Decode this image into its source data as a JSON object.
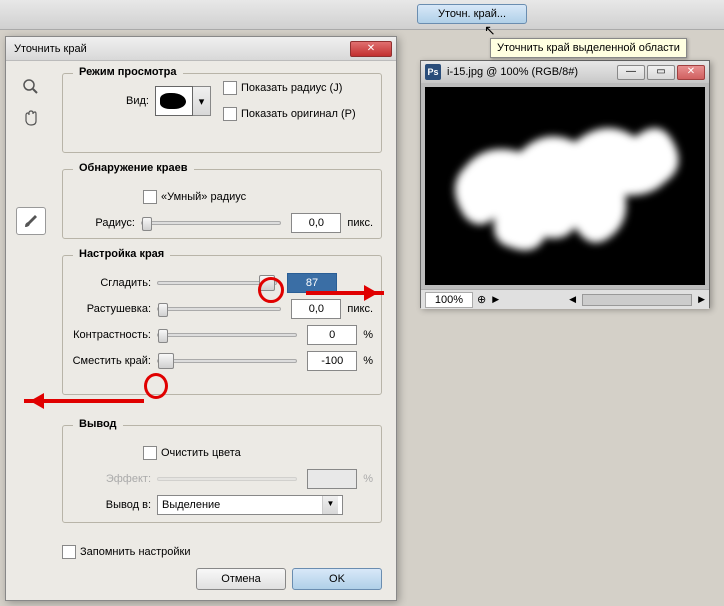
{
  "topbar": {
    "btn": "Уточн. край...",
    "tooltip": "Уточнить край выделенной области"
  },
  "dialog": {
    "title": "Уточнить край",
    "grp_view": {
      "title": "Режим просмотра",
      "vid": "Вид:",
      "show_radius": "Показать радиус (J)",
      "show_orig": "Показать оригинал (P)"
    },
    "grp_edge": {
      "title": "Обнаружение краев",
      "smart": "«Умный» радиус",
      "radius_lbl": "Радиус:",
      "radius_val": "0,0",
      "unit": "пикс."
    },
    "grp_adj": {
      "title": "Настройка края",
      "smooth_lbl": "Сгладить:",
      "smooth_val": "87",
      "feather_lbl": "Растушевка:",
      "feather_val": "0,0",
      "feather_unit": "пикс.",
      "contrast_lbl": "Контрастность:",
      "contrast_val": "0",
      "contrast_unit": "%",
      "shift_lbl": "Сместить край:",
      "shift_val": "-100",
      "shift_unit": "%"
    },
    "grp_out": {
      "title": "Вывод",
      "clean": "Очистить цвета",
      "effect_lbl": "Эффект:",
      "effect_unit": "%",
      "out_lbl": "Вывод в:",
      "out_val": "Выделение"
    },
    "remember": "Запомнить настройки",
    "cancel": "Отмена",
    "ok": "OK"
  },
  "imgwin": {
    "title": "i-15.jpg @ 100% (RGB/8#)",
    "zoom": "100%"
  }
}
